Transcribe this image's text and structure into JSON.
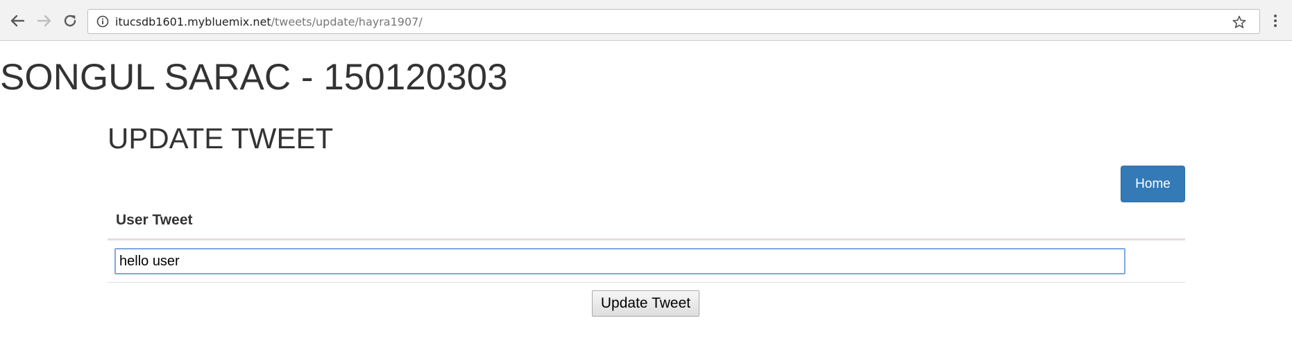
{
  "browser": {
    "url_host": "itucsdb1601.mybluemix.net",
    "url_path": "/tweets/update/hayra1907/",
    "icons": [
      "back-arrow-icon",
      "forward-arrow-icon",
      "reload-icon",
      "info-icon",
      "star-icon",
      "menu-dots-icon"
    ]
  },
  "page": {
    "heading": "SONGUL SARAC - 150120303",
    "section_heading": "UPDATE TWEET",
    "home_button": "Home",
    "table": {
      "column_header": "User Tweet",
      "tweet_value": "hello user"
    },
    "submit_button": "Update Tweet"
  },
  "colors": {
    "home_button_bg": "#337ab7",
    "input_focus_border": "#7fa6e3",
    "text": "#333333"
  }
}
